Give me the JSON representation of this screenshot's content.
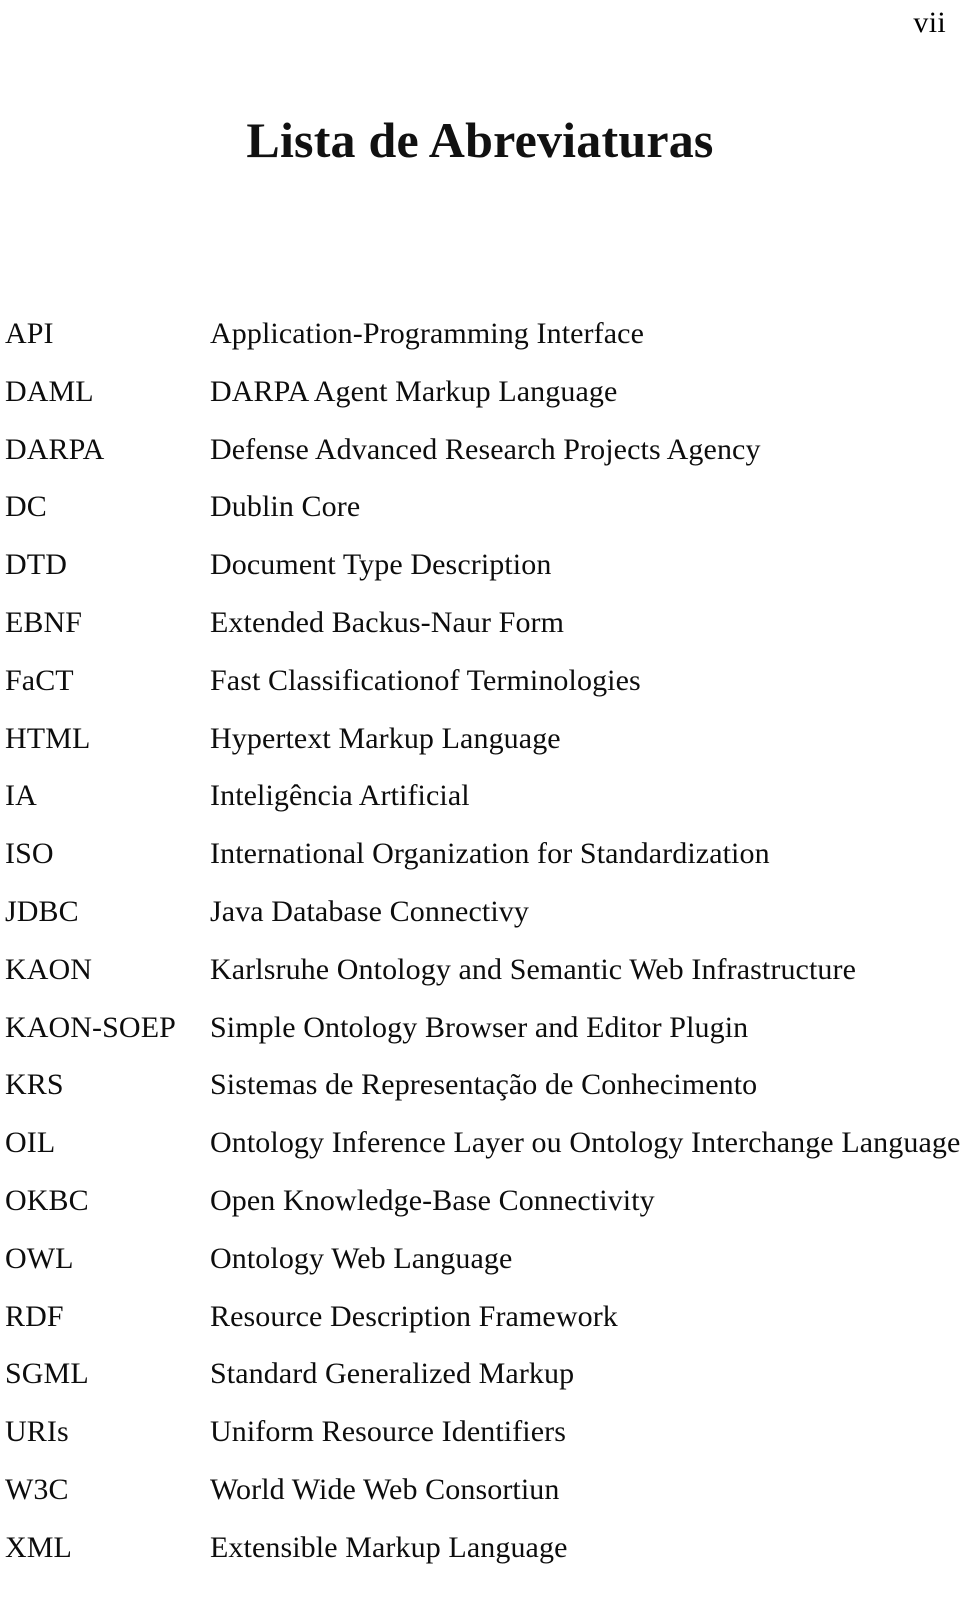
{
  "document": {
    "folio": "vii",
    "title": "Lista de Abreviaturas"
  },
  "abbreviations": [
    {
      "term": "API",
      "definition": "Application-Programming Interface"
    },
    {
      "term": "DAML",
      "definition": "DARPA Agent Markup Language"
    },
    {
      "term": "DARPA",
      "definition": "Defense Advanced Research Projects Agency"
    },
    {
      "term": "DC",
      "definition": "Dublin Core"
    },
    {
      "term": "DTD",
      "definition": "Document Type Description"
    },
    {
      "term": "EBNF",
      "definition": "Extended Backus-Naur Form"
    },
    {
      "term": "FaCT",
      "definition": "Fast Classificationof Terminologies"
    },
    {
      "term": "HTML",
      "definition": "Hypertext Markup Language"
    },
    {
      "term": "IA",
      "definition": "Inteligência Artificial"
    },
    {
      "term": "ISO",
      "definition": "International Organization for Standardization"
    },
    {
      "term": "JDBC",
      "definition": "Java Database Connectivy"
    },
    {
      "term": "KAON",
      "definition": "Karlsruhe Ontology and Semantic Web Infrastructure"
    },
    {
      "term": "KAON-SOEP",
      "definition": "Simple Ontology Browser and Editor Plugin"
    },
    {
      "term": "KRS",
      "definition": "Sistemas de Representação de Conhecimento"
    },
    {
      "term": "OIL",
      "definition": "Ontology Inference Layer ou Ontology Interchange Language"
    },
    {
      "term": "OKBC",
      "definition": "Open Knowledge-Base Connectivity"
    },
    {
      "term": "OWL",
      "definition": "Ontology Web Language"
    },
    {
      "term": "RDF",
      "definition": "Resource Description Framework"
    },
    {
      "term": "SGML",
      "definition": "Standard Generalized Markup"
    },
    {
      "term": "URIs",
      "definition": "Uniform Resource Identifiers"
    },
    {
      "term": "W3C",
      "definition": "World Wide Web Consortiun"
    },
    {
      "term": "XML",
      "definition": "Extensible Markup Language"
    }
  ]
}
